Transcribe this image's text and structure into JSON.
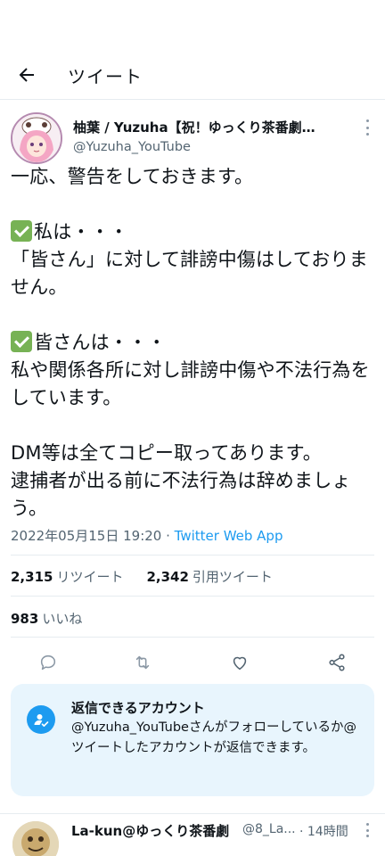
{
  "header": {
    "title": "ツイート"
  },
  "author": {
    "name": "柚葉 / Yuzuha【祝！ゆっくり茶番劇…",
    "handle": "@Yuzuha_YouTube"
  },
  "tweet": {
    "line1": "一応、警告をしておきます。",
    "block1_head": "私は・・・",
    "block1_body": "「皆さん」に対して誹謗中傷はしておりません。",
    "block2_head": "皆さんは・・・",
    "block2_body": "私や関係各所に対し誹謗中傷や不法行為をしています。",
    "block3": "DM等は全てコピー取ってあります。\n逮捕者が出る前に不法行為は辞めましょう。"
  },
  "meta": {
    "datetime": "2022年05月15日 19:20",
    "separator": " · ",
    "source": "Twitter Web App"
  },
  "stats": {
    "retweets_count": "2,315",
    "retweets_label": "リツイート",
    "quotes_count": "2,342",
    "quotes_label": "引用ツイート",
    "likes_count": "983",
    "likes_label": "いいね"
  },
  "icons": [
    "back-arrow-icon",
    "more-icon",
    "reply-icon",
    "retweet-icon",
    "like-icon",
    "share-icon",
    "reply-restriction-icon"
  ],
  "reply_card": {
    "title": "返信できるアカウント",
    "text": "@Yuzuha_YouTubeさんがフォローしているか@ツイートしたアカウントが返信できます。"
  },
  "reply_preview": {
    "name": "La-kun@ゆっくり茶番劇",
    "handle": "@8_La...",
    "time": "· 14時間"
  },
  "colors": {
    "accent": "#1d9bf0",
    "check": "#77b255",
    "muted": "#536471",
    "card_bg": "#e8f5fd"
  }
}
